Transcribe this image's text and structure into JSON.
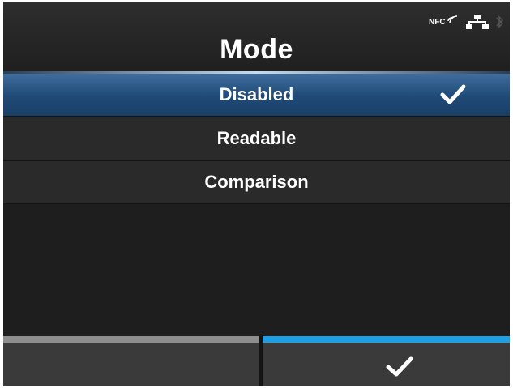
{
  "header": {
    "title": "Mode",
    "status_icons": {
      "nfc_label": "NFC",
      "nfc_icon": "nfc-icon",
      "network_icon": "network-icon"
    }
  },
  "options": [
    {
      "label": "Disabled",
      "selected": true
    },
    {
      "label": "Readable",
      "selected": false
    },
    {
      "label": "Comparison",
      "selected": false
    }
  ],
  "footer": {
    "left_button": "empty",
    "right_button_icon": "checkmark-icon"
  },
  "colors": {
    "selected_row": "#1f4a77",
    "accent_bar": "#19a0e6",
    "inactive_bar": "#8e8e8e",
    "background": "#1c1c1c"
  }
}
